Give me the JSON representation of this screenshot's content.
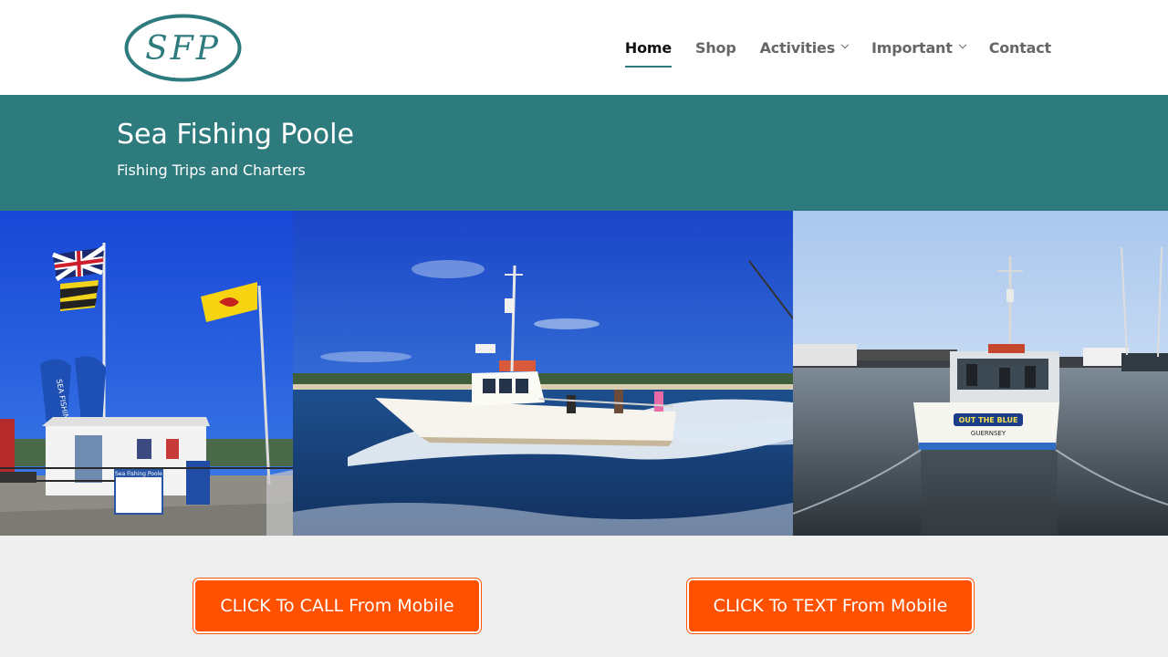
{
  "logo": {
    "text": "SFP",
    "color": "#2e7b7e"
  },
  "nav": {
    "items": [
      {
        "label": "Home",
        "active": true,
        "has_submenu": false
      },
      {
        "label": "Shop",
        "active": false,
        "has_submenu": false
      },
      {
        "label": "Activities",
        "active": false,
        "has_submenu": true
      },
      {
        "label": "Important",
        "active": false,
        "has_submenu": true
      },
      {
        "label": "Contact",
        "active": false,
        "has_submenu": false
      }
    ]
  },
  "banner": {
    "title": "Sea Fishing Poole",
    "subtitle": "Fishing Trips and Charters",
    "background": "#2e7b7e"
  },
  "photos": {
    "shop": {
      "flag_text": "SEA FISHING",
      "sign_text": "Sea Fishing Poole"
    },
    "boat": {},
    "harbour": {
      "boat_name": "OUT THE BLUE",
      "boat_home": "GUERNSEY"
    }
  },
  "buttons": {
    "call_label": "CLICK To CALL From Mobile",
    "text_label": "CLICK To TEXT From Mobile",
    "color": "#ff5100"
  }
}
